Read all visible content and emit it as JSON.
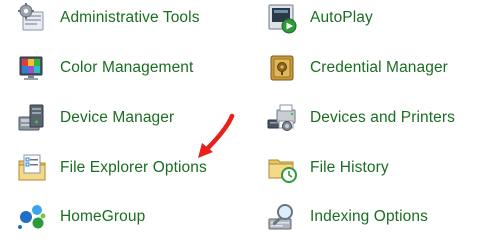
{
  "control_panel": {
    "items": [
      {
        "label": "Administrative Tools",
        "icon": "administrative-tools-icon"
      },
      {
        "label": "AutoPlay",
        "icon": "autoplay-icon"
      },
      {
        "label": "Color Management",
        "icon": "color-management-icon"
      },
      {
        "label": "Credential Manager",
        "icon": "credential-manager-icon"
      },
      {
        "label": "Device Manager",
        "icon": "device-manager-icon"
      },
      {
        "label": "Devices and Printers",
        "icon": "devices-and-printers-icon"
      },
      {
        "label": "File Explorer Options",
        "icon": "file-explorer-options-icon"
      },
      {
        "label": "File History",
        "icon": "file-history-icon"
      },
      {
        "label": "HomeGroup",
        "icon": "homegroup-icon"
      },
      {
        "label": "Indexing Options",
        "icon": "indexing-options-icon"
      }
    ],
    "link_color": "#1a6e22",
    "annotation": {
      "type": "red-arrow",
      "color": "#e8201c",
      "points_to": "File Explorer Options"
    }
  }
}
